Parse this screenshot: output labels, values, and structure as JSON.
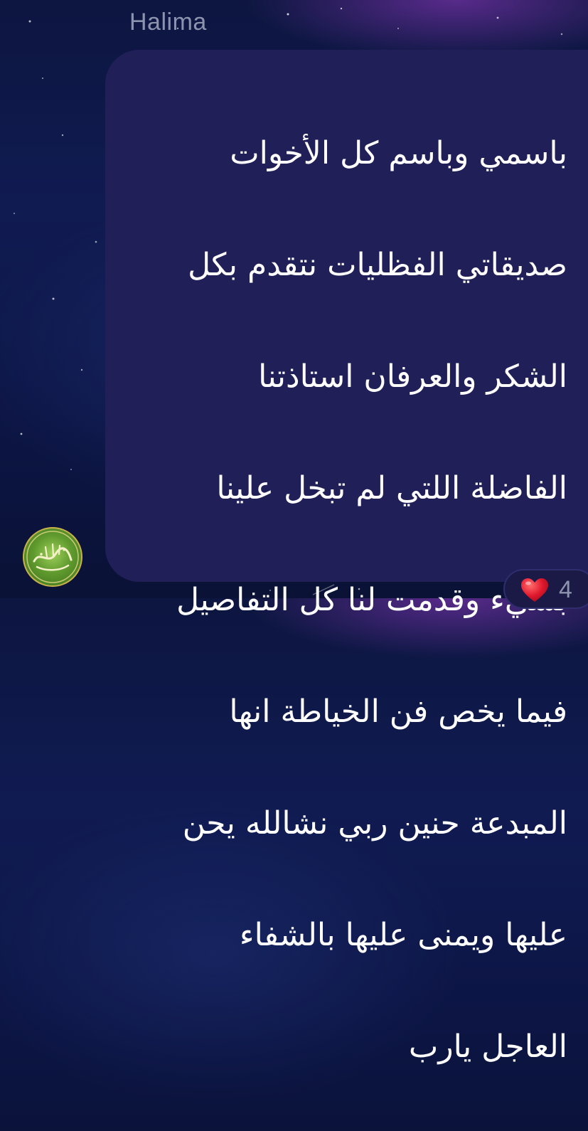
{
  "message": {
    "sender": "Halima",
    "lines": [
      "باسمي وباسم كل الأخوات",
      "صديقاتي الفظليات نتقدم بكل",
      "الشكر والعرفان استاذتنا",
      "الفاضلة اللتي لم تبخل علينا",
      "بشيء وقدمت لنا كل التفاصيل",
      "فيما يخص فن الخياطة انها",
      "المبدعة حنين ربي نشالله  يحن",
      "عليها ويمنى عليها بالشفاء",
      "العاجل يارب"
    ],
    "avatar": {
      "icon": "calligraphy-avatar-icon",
      "calligraphy_text": "رسول الله"
    },
    "reaction": {
      "emoji": "heart-icon",
      "count": "4"
    }
  },
  "colors": {
    "bubble": "#211f57",
    "sender_name": "#8c93ad",
    "text": "#ffffff",
    "heart": "#e0182d"
  }
}
